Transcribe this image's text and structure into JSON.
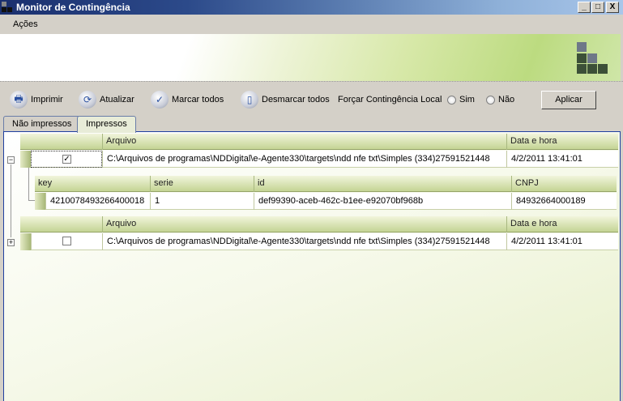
{
  "window": {
    "title": "Monitor de Contingência",
    "minimize": "_",
    "maximize": "□",
    "close": "X"
  },
  "menu": {
    "items": [
      "Ações"
    ]
  },
  "toolbar": {
    "print": "Imprimir",
    "refresh": "Atualizar",
    "check_all": "Marcar todos",
    "uncheck_all": "Desmarcar todos",
    "force_label": "Forçar Contingência Local",
    "opt_yes": "Sim",
    "opt_no": "Não",
    "apply": "Aplicar"
  },
  "tabs": [
    "Não impressos",
    "Impressos"
  ],
  "grid": {
    "columns": [
      "Arquivo",
      "Data e hora"
    ],
    "rows": [
      {
        "checked": true,
        "expanded": true,
        "arquivo": "C:\\Arquivos de programas\\NDDigital\\e-Agente330\\targets\\ndd nfe txt\\Simples (334)27591521448",
        "data": "4/2/2011 13:41:01",
        "child": {
          "columns": [
            "key",
            "serie",
            "id",
            "CNPJ"
          ],
          "row": [
            "4210078493266400018",
            "1",
            "def99390-aceb-462c-b1ee-e92070bf968b",
            "84932664000189"
          ]
        }
      },
      {
        "checked": false,
        "expanded": false,
        "arquivo": "C:\\Arquivos de programas\\NDDigital\\e-Agente330\\targets\\ndd nfe txt\\Simples (334)27591521448",
        "data": "4/2/2011 13:41:01"
      }
    ]
  }
}
